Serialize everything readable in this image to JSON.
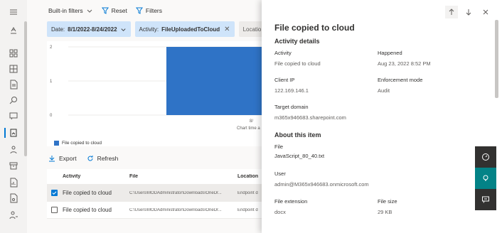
{
  "toolbar": {
    "builtin_filters": "Built-in filters",
    "reset": "Reset",
    "filters": "Filters"
  },
  "filter_pills": {
    "date_label": "Date:",
    "date_value": "8/1/2022-8/24/2022",
    "activity_label": "Activity:",
    "activity_value": "FileUploadedToCloud",
    "location_label": "Locatio"
  },
  "chart_data": {
    "type": "bar",
    "categories": [
      "8/"
    ],
    "series": [
      {
        "name": "File copied to cloud",
        "values": [
          2
        ]
      }
    ],
    "yticks": [
      "2",
      "1",
      "0"
    ],
    "ylim": [
      0,
      2
    ],
    "xlabel": "Chart time a",
    "legend_position": "bottom-left",
    "colors": {
      "bar": "#2f73c6"
    }
  },
  "actions": {
    "export": "Export",
    "refresh": "Refresh"
  },
  "table": {
    "headers": {
      "activity": "Activity",
      "file": "File",
      "location": "Location"
    },
    "rows": [
      {
        "activity": "File copied to cloud",
        "file": "C:\\Users\\MODAdministrator\\Downloads\\OneDr...",
        "location": "Endpoint d",
        "selected": true
      },
      {
        "activity": "File copied to cloud",
        "file": "C:\\Users\\MODAdministrator\\Downloads\\OneDr...",
        "location": "Endpoint d",
        "selected": false
      }
    ]
  },
  "panel": {
    "title": "File copied to cloud",
    "activity_details_heading": "Activity details",
    "activity": {
      "label": "Activity",
      "value": "File copied to cloud"
    },
    "happened": {
      "label": "Happened",
      "value": "Aug 23, 2022 8:52 PM"
    },
    "client_ip": {
      "label": "Client IP",
      "value": "122.169.146.1"
    },
    "enforcement": {
      "label": "Enforcement mode",
      "value": "Audit"
    },
    "target_domain": {
      "label": "Target domain",
      "value": "m365x946683.sharepoint.com"
    },
    "about_heading": "About this item",
    "file": {
      "label": "File",
      "value": "JavaScript_80_40.txt"
    },
    "user": {
      "label": "User",
      "value": "admin@M365x946683.onmicrosoft.com"
    },
    "file_extension": {
      "label": "File extension",
      "value": "docx"
    },
    "file_size": {
      "label": "File size",
      "value": "29 KB"
    }
  },
  "colors": {
    "accent": "#0078d4",
    "teal": "#038387",
    "pill": "#cfe4fa"
  }
}
